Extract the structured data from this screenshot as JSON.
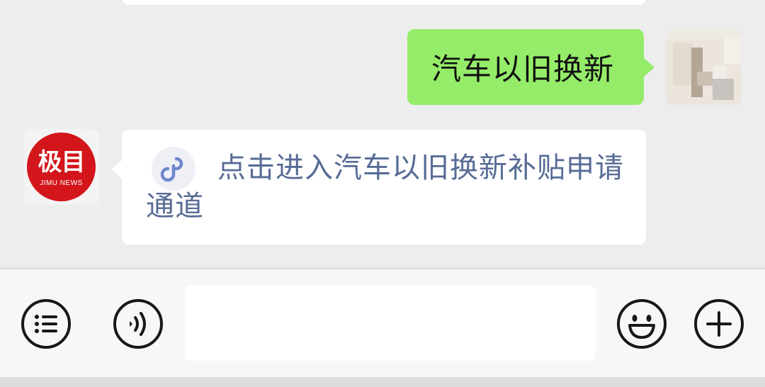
{
  "chat": {
    "messages": [
      {
        "direction": "outgoing",
        "sender": "self",
        "text": "汽车以旧换新",
        "bubble_color": "#95ec69"
      },
      {
        "direction": "incoming",
        "sender": "jimu-news",
        "avatar": {
          "title": "极目",
          "subtitle": "JIMU NEWS",
          "color": "#d3161b"
        },
        "link_icon": "mini-program-icon",
        "text": "点击进入汽车以旧换新补贴申请通道",
        "link_color": "#576b95"
      }
    ]
  },
  "toolbar": {
    "menu_icon": "list-menu-icon",
    "voice_icon": "voice-input-icon",
    "input_value": "",
    "emoji_icon": "emoji-icon",
    "plus_icon": "plus-icon"
  },
  "theme": {
    "chat_background": "#ededed",
    "toolbar_background": "#f7f7f7"
  }
}
